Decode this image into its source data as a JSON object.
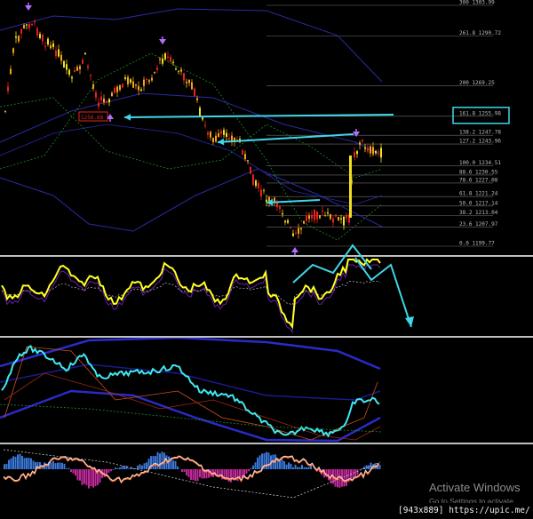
{
  "fib_levels": [
    {
      "label": "300 1303.99",
      "price": 1303.99
    },
    {
      "label": "261.8 1290.72",
      "price": 1290.72
    },
    {
      "label": "200 1269.25",
      "price": 1269.25
    },
    {
      "label": "161.8 1255.98",
      "price": 1255.98
    },
    {
      "label": "138.2 1247.78",
      "price": 1247.78
    },
    {
      "label": "127.2 1243.96",
      "price": 1243.96
    },
    {
      "label": "100.0 1234.51",
      "price": 1234.51
    },
    {
      "label": "88.6 1230.55",
      "price": 1230.55
    },
    {
      "label": "78.6 1227.08",
      "price": 1227.08
    },
    {
      "label": "61.8 1221.24",
      "price": 1221.24
    },
    {
      "label": "50.0 1217.14",
      "price": 1217.14
    },
    {
      "label": "38.2 1213.04",
      "price": 1213.04
    },
    {
      "label": "23.6 1207.97",
      "price": 1207.97
    },
    {
      "label": "0.0 1199.77",
      "price": 1199.77
    }
  ],
  "highlight_level": "161.8 1255.98",
  "price_tag": "1256.68",
  "colors": {
    "background": "#000000",
    "candle_up": "#f7a21a",
    "candle_down": "#e8231e",
    "candle_neutral": "#f0e020",
    "annotation": "#3fd8e8",
    "arrow_marker": "#b46cff",
    "band_blue": "#2a2aa8",
    "band_green": "#1e8c2a",
    "oscillator_yellow": "#ffff20",
    "oscillator_cyan": "#40e8f0",
    "hist_blue": "#3a78d8",
    "hist_magenta": "#c02a9a",
    "separator": "#bfbfbf"
  },
  "watermark": {
    "title": "Activate Windows",
    "subtitle": "Go to Settings to activate Windows."
  },
  "footer": "[943x889] https://upic.me/"
}
